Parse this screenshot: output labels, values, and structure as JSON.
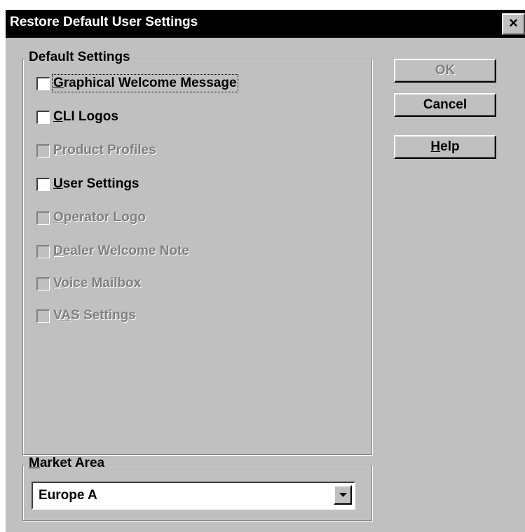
{
  "window": {
    "title": "Restore Default User Settings",
    "close_symbol": "×"
  },
  "default_settings": {
    "label": "Default Settings",
    "items": [
      {
        "before": "",
        "mnemonic": "G",
        "after": "raphical Welcome Message",
        "checked": false,
        "enabled": true,
        "focused": true
      },
      {
        "before": "",
        "mnemonic": "C",
        "after": "LI Logos",
        "checked": false,
        "enabled": true,
        "focused": false
      },
      {
        "before": "",
        "mnemonic": "P",
        "after": "roduct Profiles",
        "checked": false,
        "enabled": false,
        "focused": false
      },
      {
        "before": "",
        "mnemonic": "U",
        "after": "ser Settings",
        "checked": false,
        "enabled": true,
        "focused": false
      },
      {
        "before": "",
        "mnemonic": "O",
        "after": "perator Logo",
        "checked": false,
        "enabled": false,
        "focused": false
      },
      {
        "before": "",
        "mnemonic": "D",
        "after": "ealer Welcome Note",
        "checked": false,
        "enabled": false,
        "focused": false
      },
      {
        "before": "",
        "mnemonic": "V",
        "after": "oice Mailbox",
        "checked": false,
        "enabled": false,
        "focused": false
      },
      {
        "before": "V",
        "mnemonic": "A",
        "after": "S Settings",
        "checked": false,
        "enabled": false,
        "focused": false
      }
    ]
  },
  "buttons": {
    "ok": {
      "label": "OK",
      "enabled": false
    },
    "cancel": {
      "label": "Cancel",
      "enabled": true
    },
    "help": {
      "before": "",
      "mnemonic": "H",
      "after": "elp",
      "enabled": true
    }
  },
  "market_area": {
    "label_mnemonic": "M",
    "label_rest": "arket Area",
    "selected": "Europe A"
  },
  "colors": {
    "face": "#c0c0c0",
    "title_bar": "#000000",
    "disabled_text": "#808080"
  }
}
